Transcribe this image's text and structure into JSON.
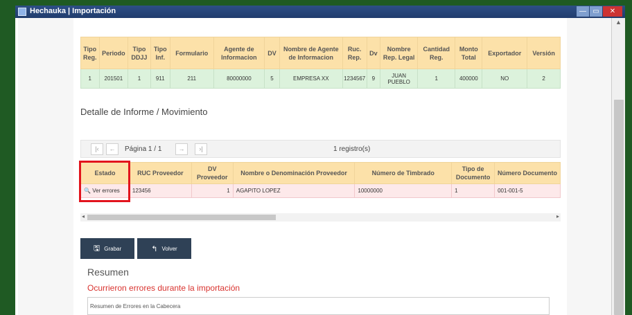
{
  "window": {
    "title": "Hechauka | Importación"
  },
  "window_buttons": {
    "minimize": "—",
    "maximize": "▭",
    "close": "✕"
  },
  "header_table": {
    "columns": [
      "Tipo Reg.",
      "Periodo",
      "Tipo DDJJ",
      "Tipo Inf.",
      "Formulario",
      "Agente de Informacion",
      "DV",
      "Nombre de Agente de Informacion",
      "Ruc. Rep.",
      "Dv",
      "Nombre Rep. Legal",
      "Cantidad Reg.",
      "Monto Total",
      "Exportador",
      "Versión"
    ],
    "row": [
      "1",
      "201501",
      "1",
      "911",
      "211",
      "80000000",
      "5",
      "EMPRESA XX",
      "1234567",
      "9",
      "JUAN PUEBLO",
      "1",
      "400000",
      "NO",
      "2"
    ]
  },
  "section_title": "Detalle de Informe / Movimiento",
  "pager": {
    "page_label": "Página 1 / 1",
    "count_label": "1 registro(s)"
  },
  "detail_table": {
    "columns": [
      "Estado",
      "RUC Proveedor",
      "DV Proveedor",
      "Nombre o Denominación Proveedor",
      "Número de Timbrado",
      "Tipo de Documento",
      "Número Documento"
    ],
    "row": [
      "Ver errores",
      "123456",
      "1",
      "AGAPITO LOPEZ",
      "10000000",
      "1",
      "001-001-5"
    ]
  },
  "buttons": {
    "grabar": "Grabar",
    "volver": "Volver"
  },
  "summary": {
    "title": "Resumen",
    "error_message": "Ocurrieron errores durante la importación",
    "detail_text": "Resumen de Errores en la Cabecera"
  },
  "colors": {
    "header_bg": "#fce1a9",
    "ok_row": "#dcf2dc",
    "error_row": "#fde9ea",
    "highlight": "#e2141d",
    "error_text": "#d9332f",
    "button_bg": "#2f4156"
  }
}
